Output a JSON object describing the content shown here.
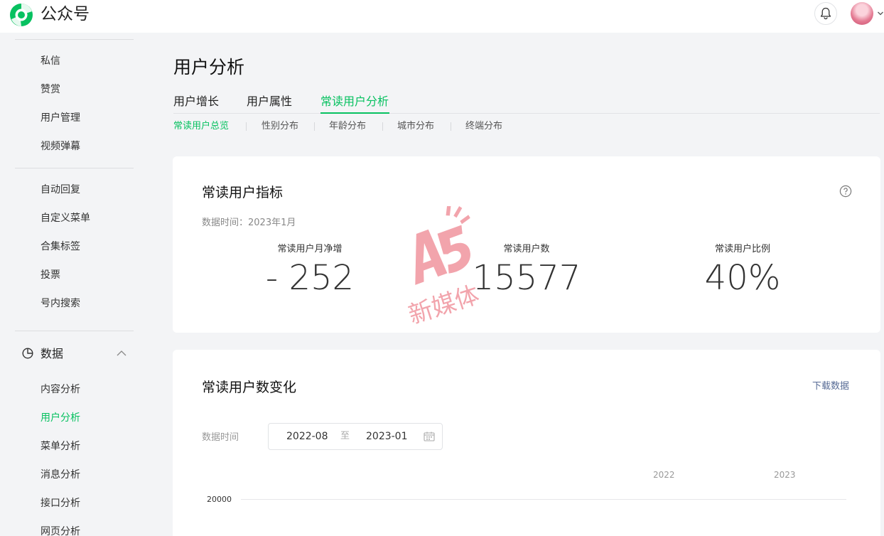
{
  "header": {
    "brand": "公众号",
    "colors": {
      "brand_green": "#07c160"
    }
  },
  "sidebar": {
    "items_a": [
      "私信",
      "赞赏",
      "用户管理",
      "视频弹幕"
    ],
    "items_b": [
      "自动回复",
      "自定义菜单",
      "合集标签",
      "投票",
      "号内搜索"
    ],
    "group": {
      "label": "数据",
      "icon": "pie-chart-icon"
    },
    "items_c": [
      "内容分析",
      "用户分析",
      "菜单分析",
      "消息分析",
      "接口分析",
      "网页分析"
    ],
    "active": "用户分析"
  },
  "main": {
    "title": "用户分析",
    "tabs": [
      "用户增长",
      "用户属性",
      "常读用户分析"
    ],
    "active_tab": "常读用户分析",
    "subtabs": [
      "常读用户总览",
      "性别分布",
      "年龄分布",
      "城市分布",
      "终端分布"
    ],
    "active_subtab": "常读用户总览",
    "metrics_card": {
      "title": "常读用户指标",
      "data_time": "数据时间：2023年1月",
      "metrics": [
        {
          "label": "常读用户月净增",
          "value": "- 252"
        },
        {
          "label": "常读用户数",
          "value": "15577"
        },
        {
          "label": "常读用户比例",
          "value": "40%"
        }
      ]
    },
    "trend_card": {
      "title": "常读用户数变化",
      "download": "下载数据",
      "range_label": "数据时间",
      "range_start": "2022-08",
      "range_to": "至",
      "range_end": "2023-01",
      "years": [
        "2022",
        "2023"
      ],
      "y_tick": "20000"
    }
  },
  "watermark": {
    "text": "新媒体"
  }
}
